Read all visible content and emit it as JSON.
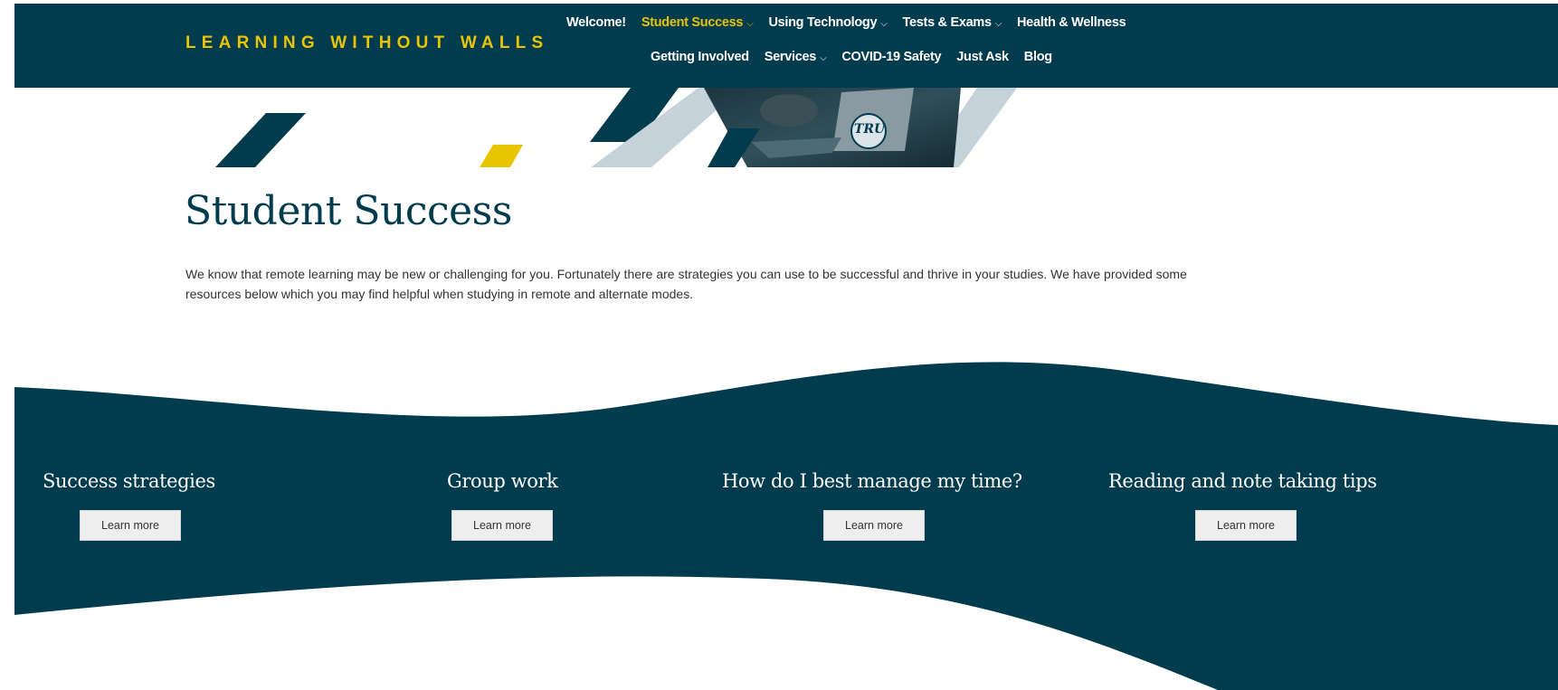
{
  "site": {
    "brand": "LEARNING WITHOUT WALLS",
    "colors": {
      "primary": "#003b4e",
      "accent": "#e9c400",
      "light_stripe": "#c5d2d9"
    }
  },
  "nav": {
    "row1": [
      {
        "label": "Welcome!",
        "has_dropdown": false,
        "active": false
      },
      {
        "label": "Student Success",
        "has_dropdown": true,
        "active": true
      },
      {
        "label": "Using Technology",
        "has_dropdown": true,
        "active": false
      },
      {
        "label": "Tests & Exams",
        "has_dropdown": true,
        "active": false
      },
      {
        "label": "Health & Wellness",
        "has_dropdown": false,
        "active": false
      }
    ],
    "row2": [
      {
        "label": "Getting Involved",
        "has_dropdown": false,
        "active": false
      },
      {
        "label": "Services",
        "has_dropdown": true,
        "active": false
      },
      {
        "label": "COVID-19 Safety",
        "has_dropdown": false,
        "active": false
      },
      {
        "label": "Just Ask",
        "has_dropdown": false,
        "active": false
      },
      {
        "label": "Blog",
        "has_dropdown": false,
        "active": false
      }
    ],
    "dropdown_icon": "chevron-down-icon",
    "dropdown_glyph": "⌵"
  },
  "hero": {
    "laptop_sticker_text": "TRU"
  },
  "page": {
    "title": "Student Success",
    "intro": "We know that remote learning may be new or challenging for you. Fortunately there are strategies you can use to be successful and thrive in your studies. We have provided some resources below which you may find helpful when studying in remote and alternate modes."
  },
  "cards": [
    {
      "title": "Success strategies",
      "button": "Learn more"
    },
    {
      "title": "Group work",
      "button": "Learn more"
    },
    {
      "title": "How do I best manage my time?",
      "button": "Learn more"
    },
    {
      "title": "Reading and note taking tips",
      "button": "Learn more"
    }
  ]
}
